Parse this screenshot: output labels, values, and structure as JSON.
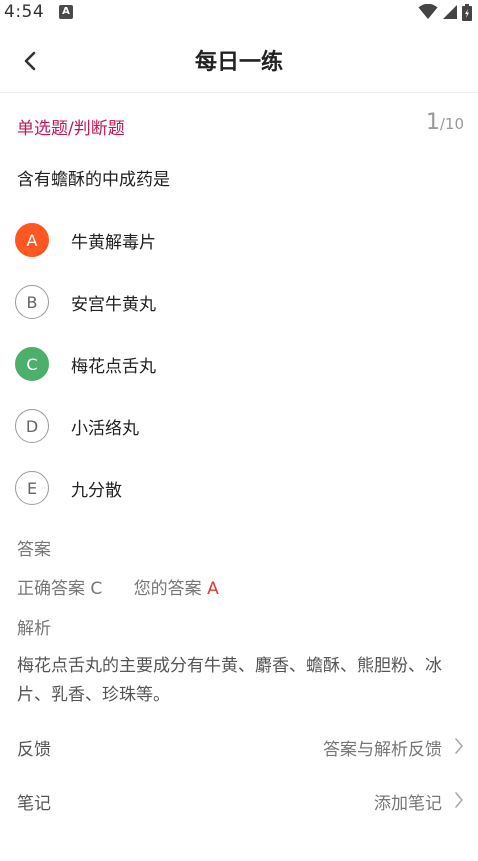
{
  "status_bar": {
    "time": "4:54",
    "app_icon_letter": "A",
    "icons": [
      "wifi-icon",
      "signal-icon",
      "battery-icon"
    ]
  },
  "header": {
    "title": "每日一练",
    "back_icon": "chevron-left-icon"
  },
  "question": {
    "type_label": "单选题/判断题",
    "progress_current": "1",
    "progress_total": "/10",
    "text": "含有蟾酥的中成药是"
  },
  "options": [
    {
      "letter": "A",
      "text": "牛黄解毒片",
      "state": "selected-wrong"
    },
    {
      "letter": "B",
      "text": "安宫牛黄丸",
      "state": "normal"
    },
    {
      "letter": "C",
      "text": "梅花点舌丸",
      "state": "correct"
    },
    {
      "letter": "D",
      "text": "小活络丸",
      "state": "normal"
    },
    {
      "letter": "E",
      "text": "九分散",
      "state": "normal"
    }
  ],
  "answer": {
    "section_label": "答案",
    "correct_label": "正确答案",
    "correct_value": "C",
    "your_label": "您的答案",
    "your_value": "A"
  },
  "analysis": {
    "section_label": "解析",
    "text": "梅花点舌丸的主要成分有牛黄、麝香、蟾酥、熊胆粉、冰片、乳香、珍珠等。"
  },
  "feedback": {
    "label": "反馈",
    "action": "答案与解析反馈"
  },
  "notes": {
    "label": "笔记",
    "action": "添加笔记"
  },
  "colors": {
    "accent_pink": "#c2185b",
    "wrong_orange": "#ff5722",
    "correct_green": "#4caf6a",
    "your_answer_red": "#e53935"
  }
}
